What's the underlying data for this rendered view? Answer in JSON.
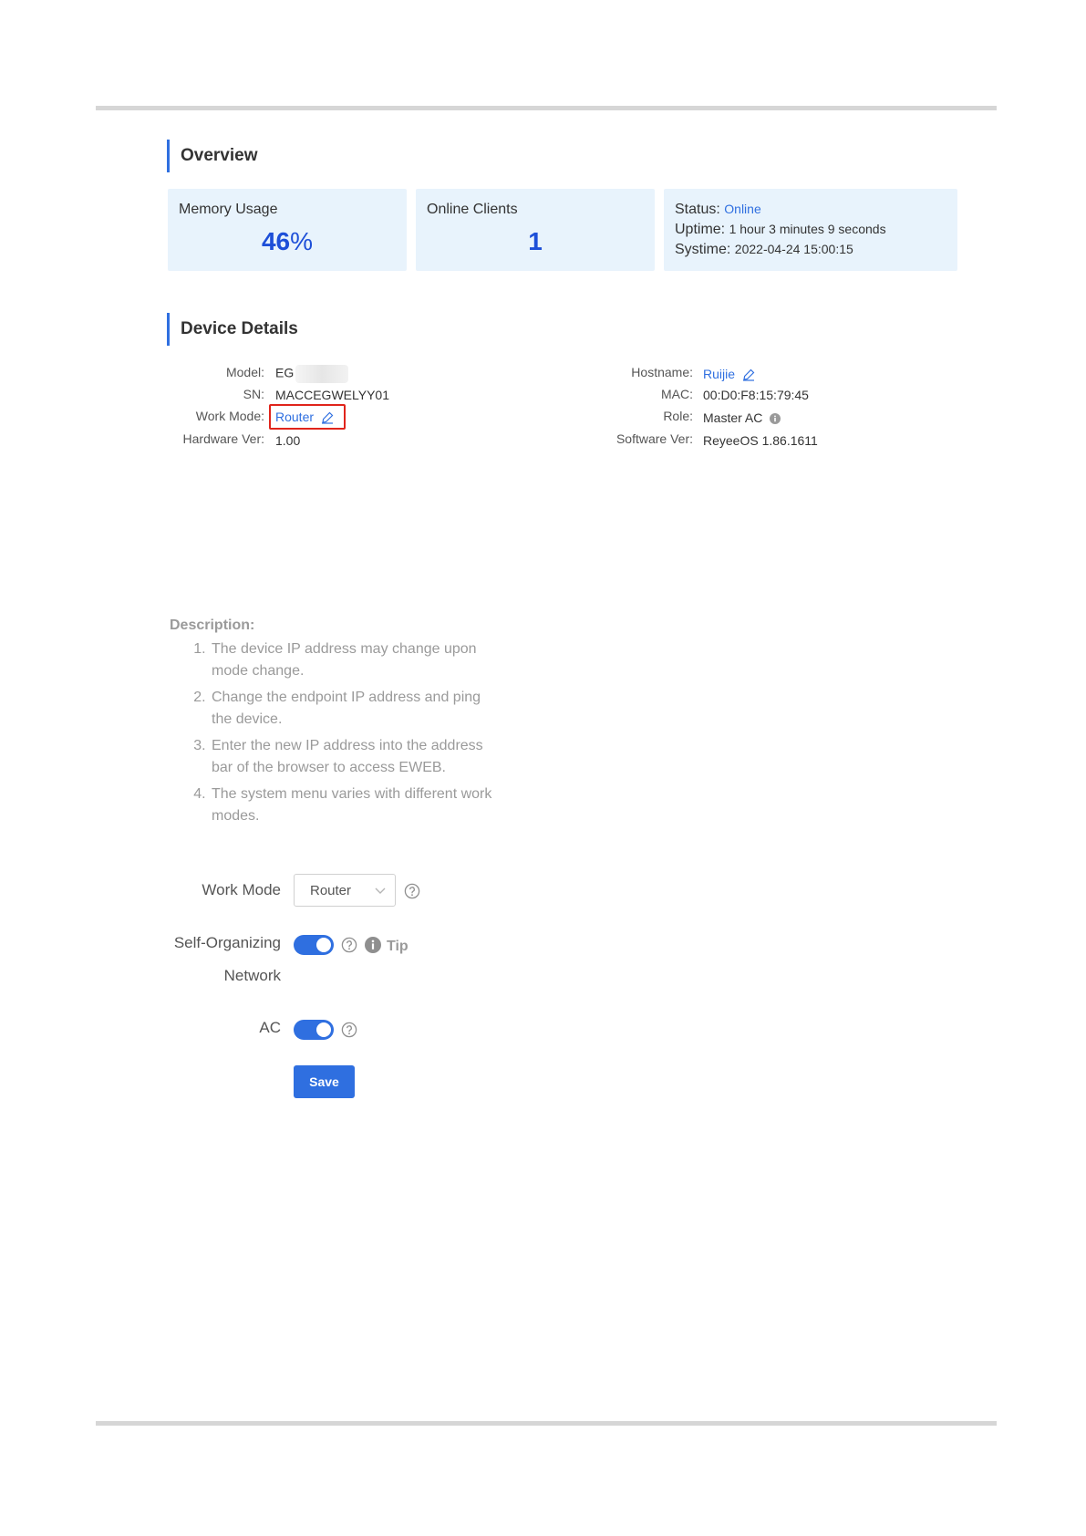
{
  "overview": {
    "title": "Overview",
    "memory_usage": {
      "label": "Memory Usage",
      "value": "46",
      "unit": "%"
    },
    "online_clients": {
      "label": "Online Clients",
      "value": "1"
    },
    "status": {
      "status_label": "Status:",
      "status_value": "Online",
      "uptime_label": "Uptime:",
      "uptime_value": "1 hour 3 minutes 9 seconds",
      "systime_label": "Systime:",
      "systime_value": "2022-04-24 15:00:15"
    }
  },
  "device_details": {
    "title": "Device Details",
    "model_label": "Model:",
    "model_value": "EG",
    "sn_label": "SN:",
    "sn_value": "MACCEGWELYY01",
    "work_mode_label": "Work Mode:",
    "work_mode_value": "Router",
    "hardware_label": "Hardware Ver:",
    "hardware_value": "1.00",
    "hostname_label": "Hostname:",
    "hostname_value": "Ruijie",
    "mac_label": "MAC:",
    "mac_value": "00:D0:F8:15:79:45",
    "role_label": "Role:",
    "role_value": "Master AC",
    "software_label": "Software Ver:",
    "software_value": "ReyeeOS 1.86.1611"
  },
  "description": {
    "title": "Description:",
    "items": [
      "The device IP address may change upon mode change.",
      "Change the endpoint IP address and ping the device.",
      "Enter the new IP address into the address bar of the browser to access EWEB.",
      "The system menu varies with different work modes."
    ]
  },
  "form": {
    "work_mode_label": "Work Mode",
    "work_mode_selected": "Router",
    "self_org_label_line1": "Self-Organizing",
    "self_org_label_line2": "Network",
    "self_org_enabled": true,
    "tip_label": "Tip",
    "ac_label": "AC",
    "ac_enabled": true,
    "save_label": "Save"
  },
  "colors": {
    "accent": "#2f6fe0",
    "card_background": "#e8f3fc",
    "highlight_border": "#e0241b"
  },
  "icons": {
    "edit": "pencil-icon",
    "help": "question-circle-icon",
    "info": "info-circle-icon",
    "dropdown": "chevron-down-icon"
  }
}
